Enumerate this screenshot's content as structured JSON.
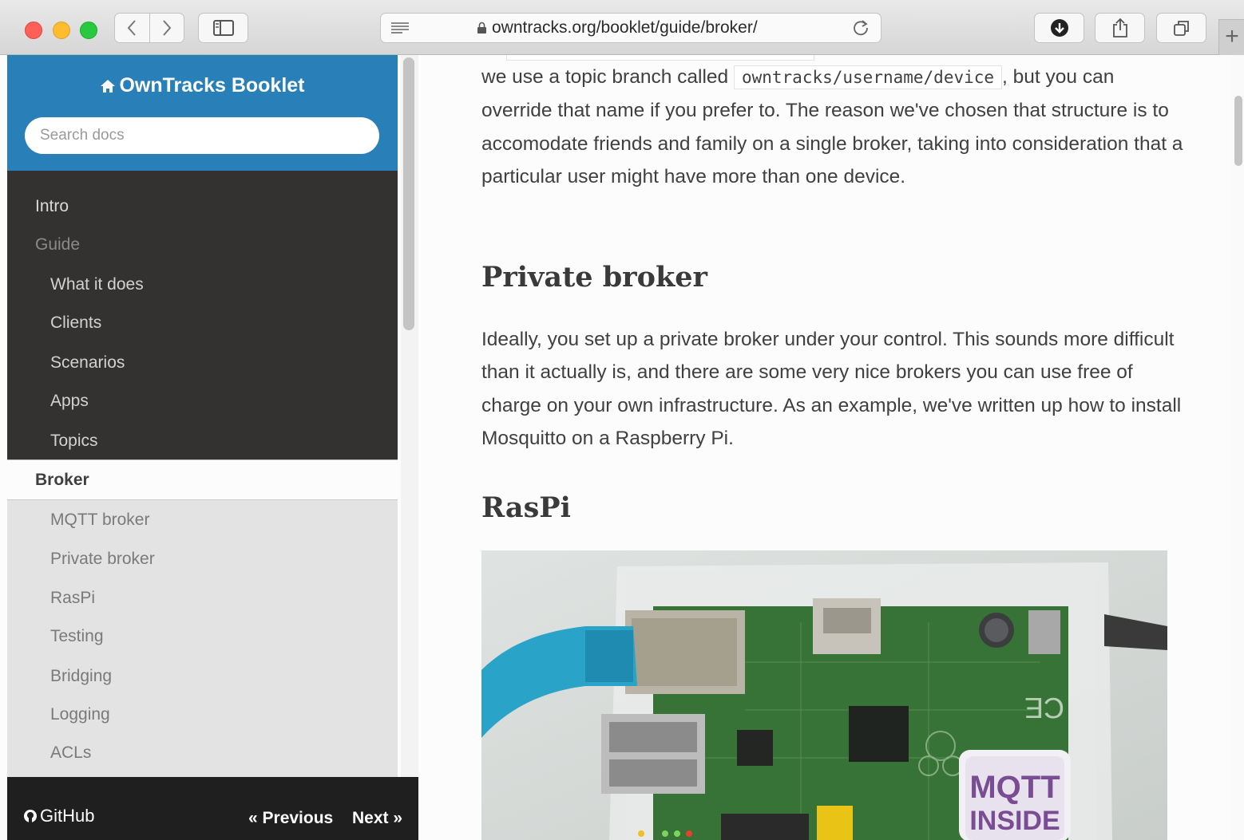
{
  "browser": {
    "url": "owntracks.org/booklet/guide/broker/"
  },
  "sidebar": {
    "brand": "OwnTracks Booklet",
    "search_placeholder": "Search docs",
    "items": [
      {
        "label": "Intro"
      },
      {
        "label": "Guide"
      },
      {
        "label": "What it does"
      },
      {
        "label": "Clients"
      },
      {
        "label": "Scenarios"
      },
      {
        "label": "Apps"
      },
      {
        "label": "Topics"
      }
    ],
    "current": "Broker",
    "subitems": [
      {
        "label": "MQTT broker"
      },
      {
        "label": "Private broker"
      },
      {
        "label": "RasPi"
      },
      {
        "label": "Testing"
      },
      {
        "label": "Bridging"
      },
      {
        "label": "Logging"
      },
      {
        "label": "ACLs"
      }
    ]
  },
  "footer": {
    "github": "GitHub",
    "previous": "« Previous",
    "next": "Next »"
  },
  "content": {
    "intro_before": "we use a topic branch called ",
    "intro_code": "owntracks/username/device",
    "intro_after": ", but you can override that name if you prefer to. The reason we've chosen that structure is to accomodate friends and family on a single broker, taking into consideration that a particular user might have more than one device.",
    "heading_private": "Private broker",
    "private_text": "Ideally, you set up a private broker under your control. This sounds more difficult than it actually is, and there are some very nice brokers you can use free of charge on your own infrastructure. As an example, we've written up how to install Mosquitto on a Raspberry Pi.",
    "heading_raspi": "RasPi",
    "image_badge_line1": "MQTT",
    "image_badge_line2": "INSIDE"
  },
  "colors": {
    "nav_header": "#2980b9",
    "nav_bg": "#343131",
    "accent_text": "#404040"
  }
}
